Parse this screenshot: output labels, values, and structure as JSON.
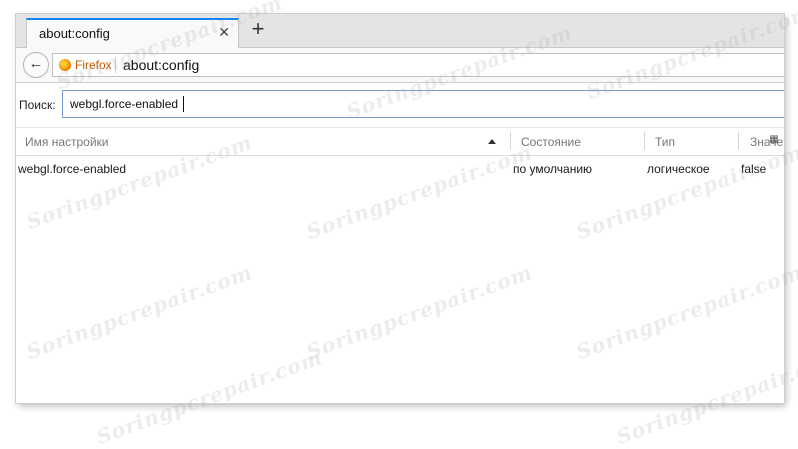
{
  "tab": {
    "title": "about:config",
    "close_glyph": "✕"
  },
  "toolbar": {
    "new_tab_glyph": "+",
    "back_glyph": "←"
  },
  "urlbar": {
    "identity_label": "Firefox",
    "url": "about:config"
  },
  "search": {
    "label": "Поиск:",
    "value": "webgl.force-enabled"
  },
  "table": {
    "columns": [
      "Имя настройки",
      "Состояние",
      "Тип",
      "Значе"
    ],
    "rows": [
      {
        "name": "webgl.force-enabled",
        "status": "по умолчанию",
        "type": "логическое",
        "value": "false"
      }
    ]
  },
  "watermark": {
    "text": "Soringpcrepair.com"
  },
  "icons": {
    "back": "back-arrow-icon",
    "firefox": "firefox-icon",
    "close": "close-icon",
    "new_tab": "plus-icon",
    "sort": "sort-ascending-icon",
    "column_picker": "column-picker-icon"
  },
  "colors": {
    "accent": "#0a84ff",
    "identity": "#c45a00",
    "input_border": "#7a9cd0"
  }
}
